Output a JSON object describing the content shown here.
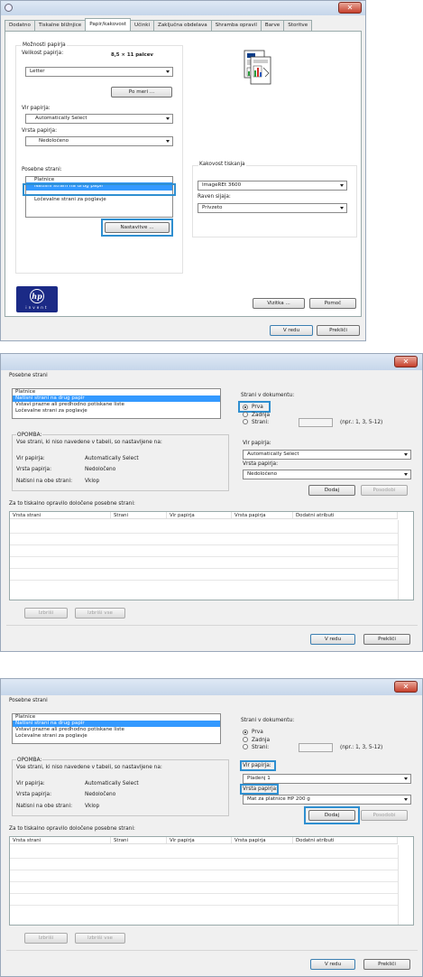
{
  "dialog1": {
    "tabs": [
      "Dodatno",
      "Tiskalne bližnjice",
      "Papir/kakovost",
      "Učinki",
      "Zaključna obdelava",
      "Shramba opravil",
      "Barve",
      "Storitve"
    ],
    "paper_options_label": "Možnosti papirja",
    "paper_size_label": "Velikost papirja:",
    "paper_size_value": "8,5 × 11 palcev",
    "paper_size_select": "Letter",
    "custom_button": "Po meri ...",
    "paper_source_label": "Vir papirja:",
    "paper_source_value": "Automatically Select",
    "paper_type_label": "Vrsta papirja:",
    "paper_type_value": "Nedoločeno",
    "special_pages_label": "Posebne strani:",
    "special_pages": [
      "Platnice",
      "Natisni strani na drug papir",
      "Ločevalne strani za poglavje"
    ],
    "settings_button": "Nastavitve ...",
    "print_quality_label": "Kakovost tiskanja",
    "print_quality_value": "ImageREt 3600",
    "gloss_label": "Raven sijaja:",
    "gloss_value": "Privzeto",
    "about_button": "Vizitka ...",
    "help_button": "Pomoč",
    "ok_button": "V redu",
    "cancel_button": "Prekliči",
    "logo_text": "invent",
    "brand_color": "#1b2a86"
  },
  "dialog2": {
    "special_pages_label": "Posebne strani",
    "list_items": [
      "Platnice",
      "Natisni strani na drug papir",
      "Vstavi prazne ali predhodno potiskane liste",
      "Ločevalne strani za poglavje"
    ],
    "pages_in_doc_label": "Strani v dokumentu:",
    "radio_first": "Prva",
    "radio_last": "Zadnja",
    "radio_pages": "Strani:",
    "pages_hint": "(npr.: 1, 3, 5-12)",
    "note_label": "OPOMBA:",
    "note_text": "Vse strani, ki niso navedene v tabeli, so nastavljene na:",
    "note_source_label": "Vir papirja:",
    "note_source_value": "Automatically Select",
    "note_type_label": "Vrsta papirja:",
    "note_type_value": "Nedoločeno",
    "note_duplex_label": "Natisni na obe strani:",
    "note_duplex_value": "Vklop",
    "source_label": "Vir papirja:",
    "source_value": "Automatically Select",
    "type_label": "Vrsta papirja:",
    "type_value": "Nedoločeno",
    "add_button": "Dodaj",
    "update_button": "Posodobi",
    "table_caption": "Za to tiskalno opravilo določene posebne strani:",
    "columns": [
      "Vrsta strani",
      "Strani",
      "Vir papirja",
      "Vrsta papirja",
      "Dodatni atributi"
    ],
    "delete_button": "Izbriši",
    "delete_all_button": "Izbriši vse",
    "ok_button": "V redu",
    "cancel_button": "Prekliči"
  },
  "dialog3": {
    "special_pages_label": "Posebne strani",
    "list_items": [
      "Platnice",
      "Natisni strani na drug papir",
      "Vstavi prazne ali predhodno potiskane liste",
      "Ločevalne strani za poglavje"
    ],
    "pages_in_doc_label": "Strani v dokumentu:",
    "radio_first": "Prva",
    "radio_last": "Zadnja",
    "radio_pages": "Strani:",
    "pages_hint": "(npr.: 1, 3, 5-12)",
    "note_label": "OPOMBA:",
    "note_text": "Vse strani, ki niso navedene v tabeli, so nastavljene na:",
    "note_source_label": "Vir papirja:",
    "note_source_value": "Automatically Select",
    "note_type_label": "Vrsta papirja:",
    "note_type_value": "Nedoločeno",
    "note_duplex_label": "Natisni na obe strani:",
    "note_duplex_value": "Vklop",
    "source_label": "Vir papirja:",
    "source_value": "Pladenj 1",
    "type_label": "Vrsta papirja:",
    "type_value": "Mat za platnice HP 200 g",
    "add_button": "Dodaj",
    "update_button": "Posodobi",
    "table_caption": "Za to tiskalno opravilo določene posebne strani:",
    "columns": [
      "Vrsta strani",
      "Strani",
      "Vir papirja",
      "Vrsta papirja",
      "Dodatni atributi"
    ],
    "delete_button": "Izbriši",
    "delete_all_button": "Izbriši vse",
    "ok_button": "V redu",
    "cancel_button": "Prekliči"
  },
  "highlight_color": "#2f8fd0"
}
